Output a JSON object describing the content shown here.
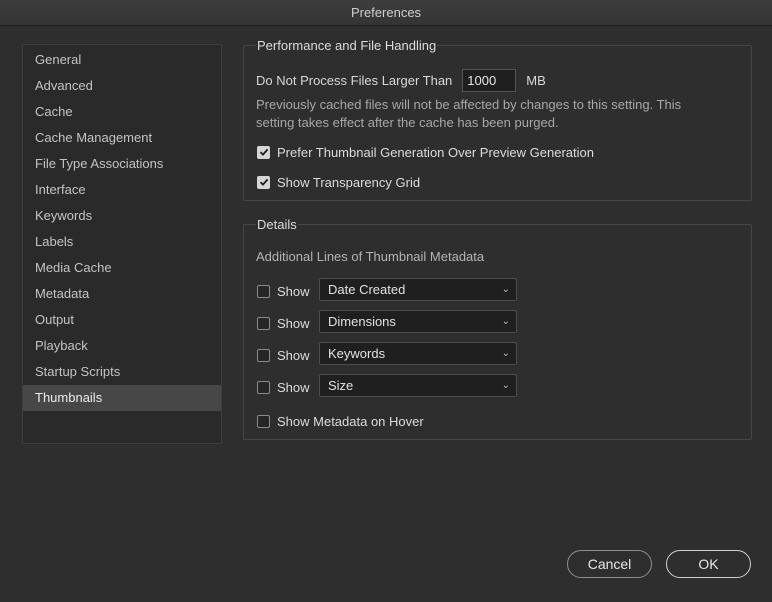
{
  "window": {
    "title": "Preferences"
  },
  "sidebar": {
    "items": [
      {
        "label": "General"
      },
      {
        "label": "Advanced"
      },
      {
        "label": "Cache"
      },
      {
        "label": "Cache Management"
      },
      {
        "label": "File Type Associations"
      },
      {
        "label": "Interface"
      },
      {
        "label": "Keywords"
      },
      {
        "label": "Labels"
      },
      {
        "label": "Media Cache"
      },
      {
        "label": "Metadata"
      },
      {
        "label": "Output"
      },
      {
        "label": "Playback"
      },
      {
        "label": "Startup Scripts"
      },
      {
        "label": "Thumbnails"
      }
    ],
    "selected": "Thumbnails"
  },
  "performance": {
    "title": "Performance and File Handling",
    "limit_label": "Do Not Process Files Larger Than",
    "limit_value": "1000",
    "limit_unit": "MB",
    "note_line1": "Previously cached files will not be affected by changes to this setting. This",
    "note_line2": "setting takes effect after the cache has been purged.",
    "prefer_thumbnail": {
      "label": "Prefer Thumbnail Generation Over Preview Generation",
      "checked": true
    },
    "show_transparency": {
      "label": "Show Transparency Grid",
      "checked": true
    }
  },
  "details": {
    "title": "Details",
    "subtitle": "Additional Lines of Thumbnail Metadata",
    "show_label": "Show",
    "rows": [
      {
        "checked": false,
        "value": "Date Created"
      },
      {
        "checked": false,
        "value": "Dimensions"
      },
      {
        "checked": false,
        "value": "Keywords"
      },
      {
        "checked": false,
        "value": "Size"
      }
    ],
    "hover": {
      "label": "Show Metadata on Hover",
      "checked": false
    }
  },
  "buttons": {
    "cancel": "Cancel",
    "ok": "OK"
  },
  "colors": {
    "background": "#2e2e2e",
    "selected_item": "#474747",
    "border": "#464646"
  }
}
